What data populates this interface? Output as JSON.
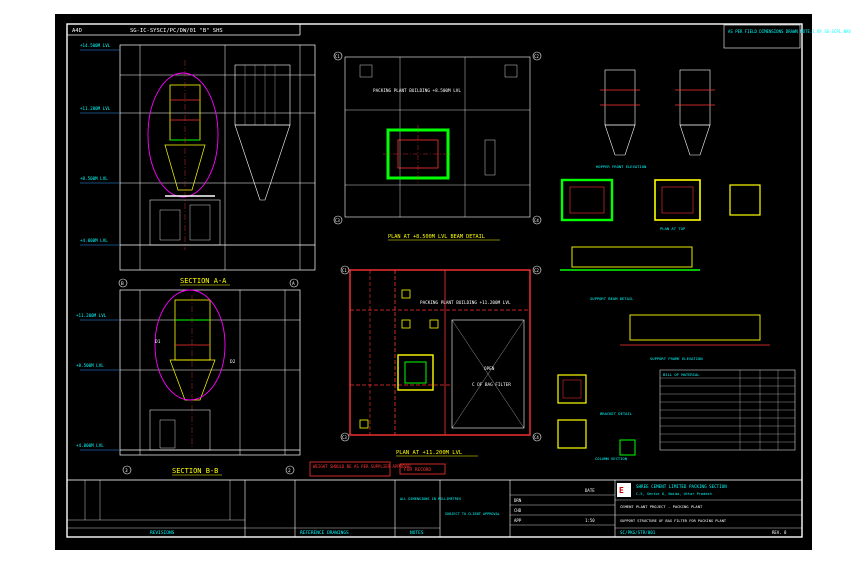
{
  "header": {
    "tag": "A4D",
    "drawing_ref": "SG-IC-SYSCI/PC/DW/01 \"B\" SHS"
  },
  "views": {
    "section_aa": {
      "title": "SECTION A-A",
      "levels": [
        "+14.500M LVL",
        "+11.200M LVL",
        "+8.500M LVL",
        "+4.000M LVL"
      ],
      "grid": [
        "B",
        "A"
      ]
    },
    "section_bb": {
      "title": "SECTION B-B",
      "levels": [
        "+11.200M LVL",
        "+8.500M LVL",
        "+4.000M LVL"
      ],
      "marks": [
        "D1",
        "D2"
      ],
      "grid": [
        "3",
        "2"
      ]
    },
    "plan_a1": {
      "title": "PLAN AT +8.500M LVL BEAM DETAIL",
      "label": "PACKING PLANT BUILDING +8.500M LVL",
      "columns": [
        "C1",
        "C2",
        "C3",
        "C4"
      ]
    },
    "plan_a7": {
      "title": "PLAN AT +11.200M LVL",
      "label": "PACKING PLANT BUILDING +11.200M LVL",
      "open_label": "OPEN",
      "filter_label": "C OF BAG FILTER",
      "columns": [
        "C1",
        "C2",
        "C3",
        "C4"
      ]
    },
    "details": {
      "hopper_front": "HOPPER FRONT ELEVATION",
      "plan_top": "PLAN AT TOP",
      "beam_title": "SUPPORT BEAM DETAIL",
      "frame_title": "SUPPORT FRAME ELEVATION",
      "bracket_title": "BRACKET DETAIL",
      "column_title": "COLUMN SECTION",
      "bom_title": "BILL OF MATERIAL"
    }
  },
  "notes": {
    "top_right": "AS PER FIELD DIMENSIONS DRAWN NOTE:1 BY SG-SCPL NAV",
    "weight_warning": "WEIGHT SHOULD BE AS PER SUPPLIER APPROVAL",
    "for_record": "FOR RECORD"
  },
  "title_block": {
    "company": "SHREE CEMENT LIMITED PACKING SECTION",
    "address": "C-5, Sector 6, Noida, Uttar Pradesh",
    "project": "CEMENT PLANT PROJECT - PACKING PLANT",
    "drawing_title": "SUPPORT STRUCTURE OF BAG FILTER FOR PACKING PLANT",
    "drawing_no": "SC/PKG/STR/001",
    "sheet_rev": "REV. 0",
    "scale": "1:50",
    "rev_label": "REVISIONS",
    "ref_label": "REFERENCE DRAWINGS",
    "notes_label": "NOTES",
    "drawn": "DRN",
    "checked": "CHD",
    "approved": "APP",
    "date_col": "DATE",
    "mid_stamp": "ALL DIMENSIONS IN MILLIMETRES",
    "approval_stamp": "SUBJECT TO CLIENT APPROVAL"
  },
  "colors": {
    "background": "#000000",
    "frame": "#ffffff",
    "structure": "#ff3333",
    "steel": "#ffff00",
    "highlight": "#00ff00",
    "annotation": "#00ffff",
    "cloud": "#ff00ff",
    "dimension": "#3399ff"
  }
}
